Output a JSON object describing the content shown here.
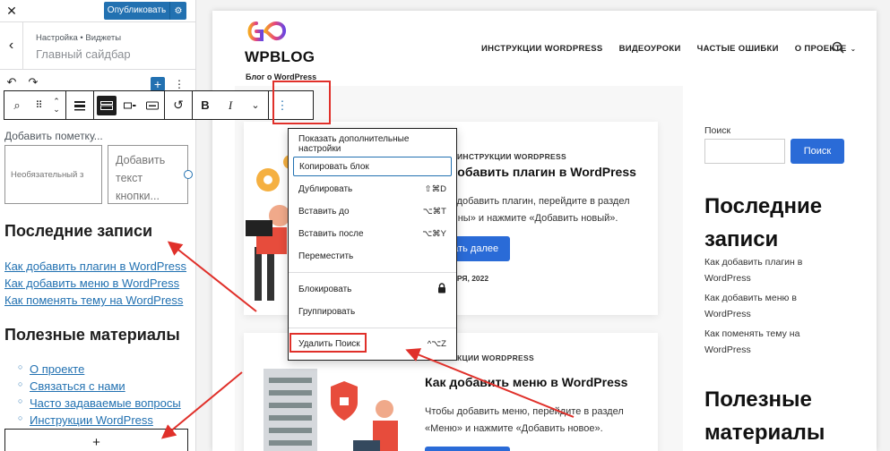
{
  "left_panel": {
    "close_icon": "close-icon",
    "publish_label": "Опубликовать",
    "breadcrumb": "Настройка • Виджеты",
    "section_title": "Главный сайдбар",
    "label_placeholder": "Добавить пометку...",
    "search_input_placeholder": "Необязательный з",
    "search_button_placeholder": "Добавить текст кнопки...",
    "recent_heading": "Последние записи",
    "recent_links": [
      "Как добавить плагин в WordPress",
      "Как добавить меню в WordPress",
      "Как поменять тему на WordPress"
    ],
    "useful_heading": "Полезные материалы",
    "useful_links": [
      "О проекте",
      "Связаться с нами",
      "Часто задаваемые вопросы",
      "Инструкции WordPress"
    ],
    "add_block_symbol": "+"
  },
  "toolbar": {
    "bold_label": "B",
    "italic_label": "I"
  },
  "context_menu": {
    "items": [
      {
        "label": "Показать дополнительные настройки",
        "shortcut": ""
      },
      {
        "label": "Копировать блок",
        "shortcut": ""
      },
      {
        "label": "Дублировать",
        "shortcut": "⇧⌘D"
      },
      {
        "label": "Вставить до",
        "shortcut": "⌥⌘T"
      },
      {
        "label": "Вставить после",
        "shortcut": "⌥⌘Y"
      },
      {
        "label": "Переместить",
        "shortcut": ""
      },
      {
        "label": "Блокировать",
        "shortcut": ""
      },
      {
        "label": "Группировать",
        "shortcut": ""
      },
      {
        "label": "Удалить Поиск",
        "shortcut": "^⌥Z"
      }
    ]
  },
  "site": {
    "title": "WPBLOG",
    "tagline": "Блог о WordPress",
    "nav": [
      "ИНСТРУКЦИИ WORDPRESS",
      "ВИДЕОУРОКИ",
      "ЧАСТЫЕ ОШИБКИ",
      "О ПРОЕКТЕ"
    ],
    "posts": [
      {
        "category": "ИНСТРУКЦИИ WORDPRESS",
        "title": "Как добавить плагин в WordPress",
        "excerpt_line1": "Чтобы добавить плагин, перейдите в раздел",
        "excerpt_line2": "«Плагины» и нажмите «Добавить новый».",
        "read_more": "Читать далее",
        "date": "14 ЯНВАРЯ, 2022"
      },
      {
        "category": "ИНСТРУКЦИИ WORDPRESS",
        "title": "Как добавить меню в WordPress",
        "excerpt_line1": "Чтобы добавить меню, перейдите в раздел",
        "excerpt_line2": "«Меню» и нажмите «Добавить новое»."
      }
    ],
    "sidebar": {
      "search_label": "Поиск",
      "search_button": "Поиск",
      "recent_heading_line1": "Последние",
      "recent_heading_line2": "записи",
      "recent_links": [
        "Как добавить плагин в WordPress",
        "Как добавить меню в WordPress",
        "Как поменять тему на WordPress"
      ],
      "useful_heading_line1": "Полезные",
      "useful_heading_line2": "материалы"
    }
  },
  "colors": {
    "wp_blue": "#2271b1",
    "site_button_blue": "#2a6bd7",
    "annotation_red": "#e0302a"
  }
}
